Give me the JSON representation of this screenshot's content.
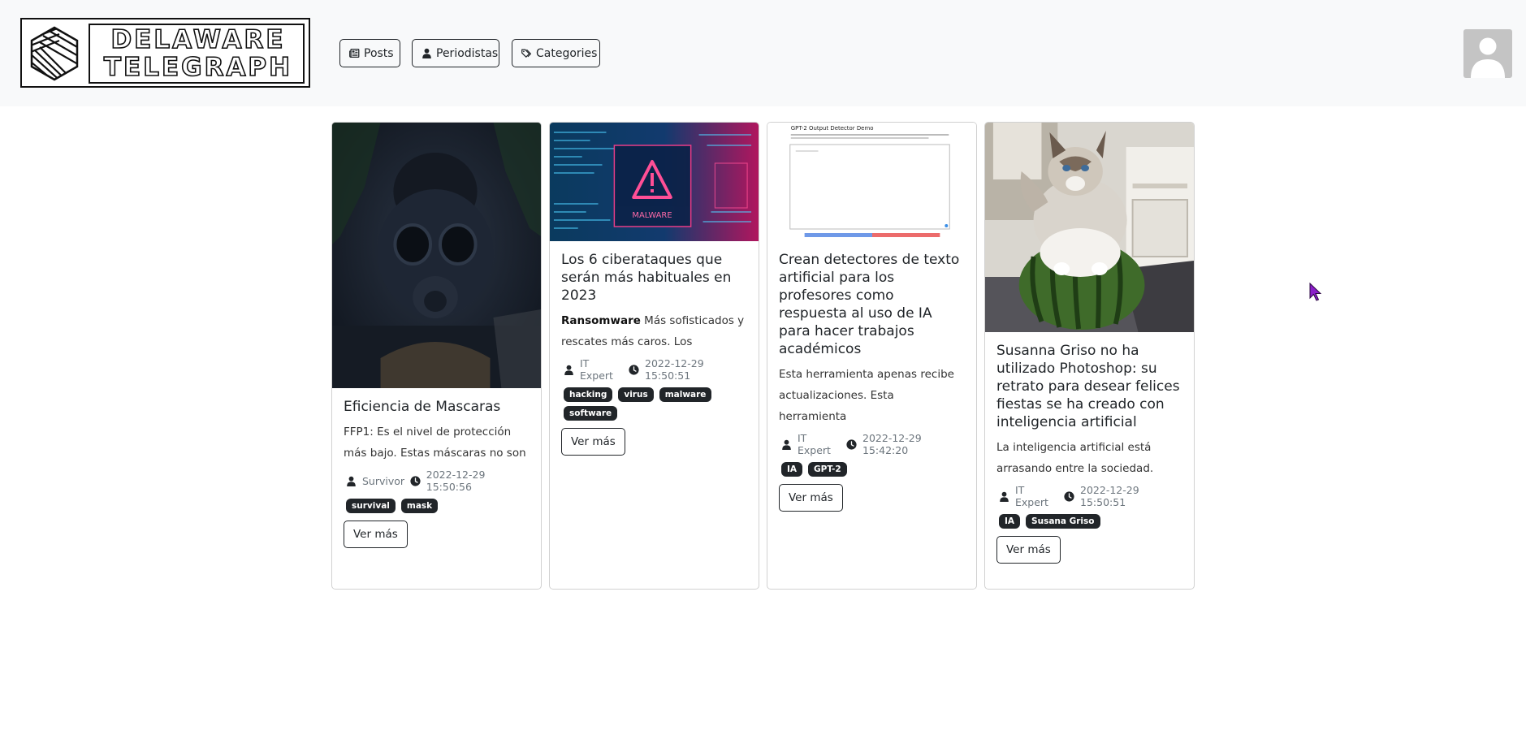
{
  "header": {
    "logo": {
      "line1": "DELAWARE",
      "line2": "TELEGRAPH"
    },
    "nav": [
      {
        "label": "Posts",
        "icon": "newspaper-icon"
      },
      {
        "label": "Periodistas",
        "icon": "user-icon"
      },
      {
        "label": "Categories",
        "icon": "tags-icon"
      }
    ],
    "avatar_icon": "user-avatar-icon"
  },
  "cards": [
    {
      "title": "Eficiencia de Mascaras",
      "excerpt_bold": "",
      "excerpt": "FFP1: Es el nivel de protección más bajo. Estas máscaras no son",
      "author": "Survivor",
      "date": "2022-12-29 15:50:56",
      "tags": [
        "survival",
        "mask"
      ],
      "button": "Ver más"
    },
    {
      "title": "Los 6 ciberataques que serán más habituales en 2023",
      "excerpt_bold": "Ransomware",
      "excerpt": " Más sofisticados y rescates más caros. Los",
      "author": "IT Expert",
      "date": "2022-12-29 15:50:51",
      "tags": [
        "hacking",
        "virus",
        "malware",
        "software"
      ],
      "button": "Ver más",
      "image_text": "MALWARE"
    },
    {
      "title": "Crean detectores de texto artificial para los profesores como respuesta al uso de IA para hacer trabajos académicos",
      "excerpt_bold": "",
      "excerpt": "Esta herramienta apenas recibe actualizaciones. Esta herramienta",
      "author": "IT Expert",
      "date": "2022-12-29 15:42:20",
      "tags": [
        "IA",
        "GPT-2"
      ],
      "button": "Ver más",
      "image_text": "GPT-2 Output Detector Demo"
    },
    {
      "title": "Susanna Griso no ha utilizado Photoshop: su retrato para desear felices fiestas se ha creado con inteligencia artificial",
      "excerpt_bold": "",
      "excerpt": "La inteligencia artificial está arrasando entre la sociedad.",
      "author": "IT Expert",
      "date": "2022-12-29 15:50:51",
      "tags": [
        "IA",
        "Susana Griso"
      ],
      "button": "Ver más"
    }
  ],
  "colors": {
    "header_bg": "#f8f9fa",
    "text": "#212529",
    "muted": "#6c757d",
    "badge": "#212529",
    "cursor": "#8a1ec9"
  }
}
